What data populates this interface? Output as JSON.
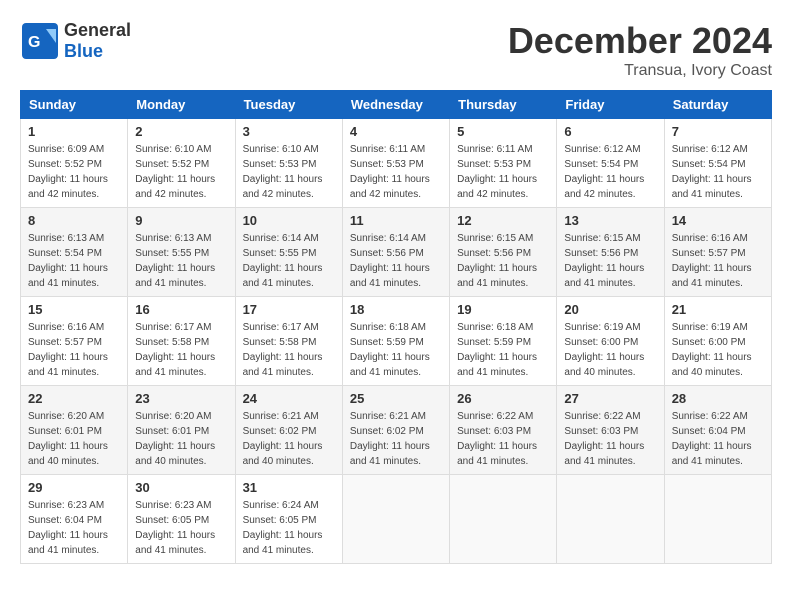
{
  "header": {
    "logo_line1": "General",
    "logo_line2": "Blue",
    "month": "December 2024",
    "location": "Transua, Ivory Coast"
  },
  "weekdays": [
    "Sunday",
    "Monday",
    "Tuesday",
    "Wednesday",
    "Thursday",
    "Friday",
    "Saturday"
  ],
  "weeks": [
    [
      {
        "day": "1",
        "sunrise": "6:09 AM",
        "sunset": "5:52 PM",
        "daylight": "11 hours and 42 minutes."
      },
      {
        "day": "2",
        "sunrise": "6:10 AM",
        "sunset": "5:52 PM",
        "daylight": "11 hours and 42 minutes."
      },
      {
        "day": "3",
        "sunrise": "6:10 AM",
        "sunset": "5:53 PM",
        "daylight": "11 hours and 42 minutes."
      },
      {
        "day": "4",
        "sunrise": "6:11 AM",
        "sunset": "5:53 PM",
        "daylight": "11 hours and 42 minutes."
      },
      {
        "day": "5",
        "sunrise": "6:11 AM",
        "sunset": "5:53 PM",
        "daylight": "11 hours and 42 minutes."
      },
      {
        "day": "6",
        "sunrise": "6:12 AM",
        "sunset": "5:54 PM",
        "daylight": "11 hours and 42 minutes."
      },
      {
        "day": "7",
        "sunrise": "6:12 AM",
        "sunset": "5:54 PM",
        "daylight": "11 hours and 41 minutes."
      }
    ],
    [
      {
        "day": "8",
        "sunrise": "6:13 AM",
        "sunset": "5:54 PM",
        "daylight": "11 hours and 41 minutes."
      },
      {
        "day": "9",
        "sunrise": "6:13 AM",
        "sunset": "5:55 PM",
        "daylight": "11 hours and 41 minutes."
      },
      {
        "day": "10",
        "sunrise": "6:14 AM",
        "sunset": "5:55 PM",
        "daylight": "11 hours and 41 minutes."
      },
      {
        "day": "11",
        "sunrise": "6:14 AM",
        "sunset": "5:56 PM",
        "daylight": "11 hours and 41 minutes."
      },
      {
        "day": "12",
        "sunrise": "6:15 AM",
        "sunset": "5:56 PM",
        "daylight": "11 hours and 41 minutes."
      },
      {
        "day": "13",
        "sunrise": "6:15 AM",
        "sunset": "5:56 PM",
        "daylight": "11 hours and 41 minutes."
      },
      {
        "day": "14",
        "sunrise": "6:16 AM",
        "sunset": "5:57 PM",
        "daylight": "11 hours and 41 minutes."
      }
    ],
    [
      {
        "day": "15",
        "sunrise": "6:16 AM",
        "sunset": "5:57 PM",
        "daylight": "11 hours and 41 minutes."
      },
      {
        "day": "16",
        "sunrise": "6:17 AM",
        "sunset": "5:58 PM",
        "daylight": "11 hours and 41 minutes."
      },
      {
        "day": "17",
        "sunrise": "6:17 AM",
        "sunset": "5:58 PM",
        "daylight": "11 hours and 41 minutes."
      },
      {
        "day": "18",
        "sunrise": "6:18 AM",
        "sunset": "5:59 PM",
        "daylight": "11 hours and 41 minutes."
      },
      {
        "day": "19",
        "sunrise": "6:18 AM",
        "sunset": "5:59 PM",
        "daylight": "11 hours and 41 minutes."
      },
      {
        "day": "20",
        "sunrise": "6:19 AM",
        "sunset": "6:00 PM",
        "daylight": "11 hours and 40 minutes."
      },
      {
        "day": "21",
        "sunrise": "6:19 AM",
        "sunset": "6:00 PM",
        "daylight": "11 hours and 40 minutes."
      }
    ],
    [
      {
        "day": "22",
        "sunrise": "6:20 AM",
        "sunset": "6:01 PM",
        "daylight": "11 hours and 40 minutes."
      },
      {
        "day": "23",
        "sunrise": "6:20 AM",
        "sunset": "6:01 PM",
        "daylight": "11 hours and 40 minutes."
      },
      {
        "day": "24",
        "sunrise": "6:21 AM",
        "sunset": "6:02 PM",
        "daylight": "11 hours and 40 minutes."
      },
      {
        "day": "25",
        "sunrise": "6:21 AM",
        "sunset": "6:02 PM",
        "daylight": "11 hours and 41 minutes."
      },
      {
        "day": "26",
        "sunrise": "6:22 AM",
        "sunset": "6:03 PM",
        "daylight": "11 hours and 41 minutes."
      },
      {
        "day": "27",
        "sunrise": "6:22 AM",
        "sunset": "6:03 PM",
        "daylight": "11 hours and 41 minutes."
      },
      {
        "day": "28",
        "sunrise": "6:22 AM",
        "sunset": "6:04 PM",
        "daylight": "11 hours and 41 minutes."
      }
    ],
    [
      {
        "day": "29",
        "sunrise": "6:23 AM",
        "sunset": "6:04 PM",
        "daylight": "11 hours and 41 minutes."
      },
      {
        "day": "30",
        "sunrise": "6:23 AM",
        "sunset": "6:05 PM",
        "daylight": "11 hours and 41 minutes."
      },
      {
        "day": "31",
        "sunrise": "6:24 AM",
        "sunset": "6:05 PM",
        "daylight": "11 hours and 41 minutes."
      },
      null,
      null,
      null,
      null
    ]
  ]
}
